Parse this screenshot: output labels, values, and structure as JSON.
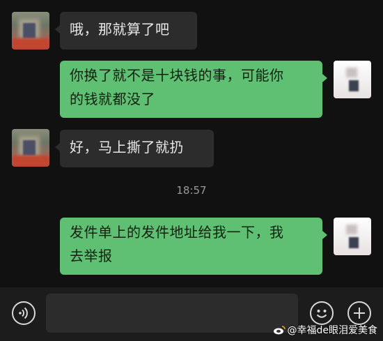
{
  "conversation": {
    "messages": [
      {
        "side": "left",
        "text": "哦，那就算了吧"
      },
      {
        "side": "right",
        "line1": "你换了就不是十块钱的事，可能你",
        "line2": "的钱就都没了"
      },
      {
        "side": "left",
        "text": "好，马上撕了就扔"
      },
      {
        "side": "right",
        "line1": "发件单上的发件地址给我一下，我",
        "line2": "去举报"
      }
    ],
    "timestamp": "18:57"
  },
  "colors": {
    "background": "#111111",
    "incoming_bubble": "#2c2c2c",
    "outgoing_bubble": "#5fbf72"
  },
  "toolbar": {
    "voice_icon": "voice-icon",
    "emoji_icon": "emoji-icon",
    "add_icon": "plus-icon"
  },
  "watermark": {
    "text": "@幸福de眼泪爱美食",
    "logo": "weibo-logo"
  }
}
